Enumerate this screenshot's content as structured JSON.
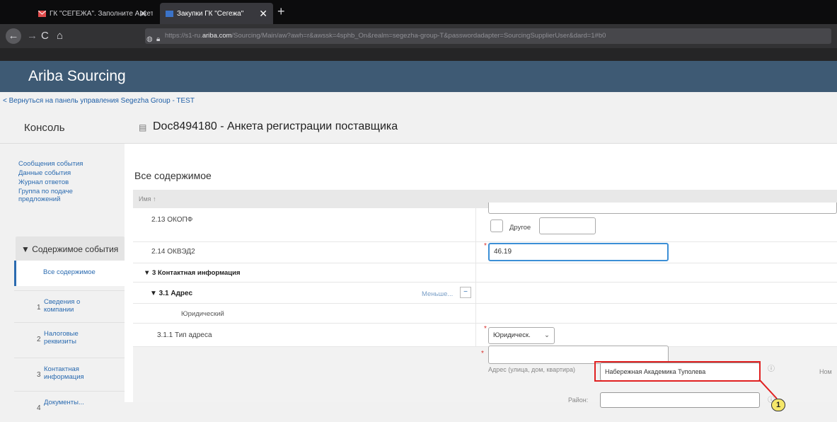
{
  "browser": {
    "tabs": [
      {
        "title": "ГК \"СЕГЕЖА\". Заполните Анкет",
        "close": "✕"
      },
      {
        "title": "Закупки ГК \"Сегежа\"",
        "close": "✕"
      }
    ],
    "new_tab": "+",
    "nav": {
      "back": "←",
      "forward": "→",
      "reload": "C",
      "home": "⌂"
    },
    "url_prefix": "https://s1-ru.",
    "url_domain": "ariba.com",
    "url_rest": "/Sourcing/Main/aw?awh=r&awssk=4sphb_On&realm=segezha-group-T&passwordadapter=SourcingSupplierUser&dard=1#b0"
  },
  "header": {
    "app_title": "Ariba Sourcing"
  },
  "back_link": "< Вернуться на панель управления Segezha Group - TEST",
  "console_title": "Консоль",
  "doc_title": "Doc8494180 - Анкета регистрации поставщика",
  "sidebar": {
    "links": [
      "Сообщения события",
      "Данные события",
      "Журнал ответов",
      "Группа по подаче предложений"
    ],
    "section": "▼ Содержимое события",
    "active": "Все содержимое",
    "items": [
      {
        "num": "1",
        "label": "Сведения о компании"
      },
      {
        "num": "2",
        "label": "Налоговые реквизиты"
      },
      {
        "num": "3",
        "label": "Контактная информация"
      },
      {
        "num": "4",
        "label": "Документы..."
      }
    ]
  },
  "main": {
    "heading": "Все содержимое",
    "col_name": "Имя ↑",
    "rows": {
      "okopf_label": "2.13  ОКОПФ",
      "other_label": "Другое",
      "okved_label": "2.14  ОКВЭД2",
      "okved_value": "46.19",
      "contact_label": "▼ 3  Контактная информация",
      "address_label": "▼ 3.1  Адрес",
      "less_link": "Меньше...",
      "less_btn": "−",
      "legal_label": "Юридический",
      "addr_type_label": "3.1.1  Тип адреса",
      "addr_type_value": "Юридическ.",
      "street_label": "Адрес (улица, дом, квартира)",
      "street_value": "Набережная Академика Туполева",
      "district_label": "Район:",
      "right_cut_label": "Ном"
    }
  },
  "callout": "1",
  "colors": {
    "header_bg": "#3e5a74",
    "link": "#2b6bb0",
    "highlight": "#e02020",
    "callout": "#f5e76a"
  }
}
